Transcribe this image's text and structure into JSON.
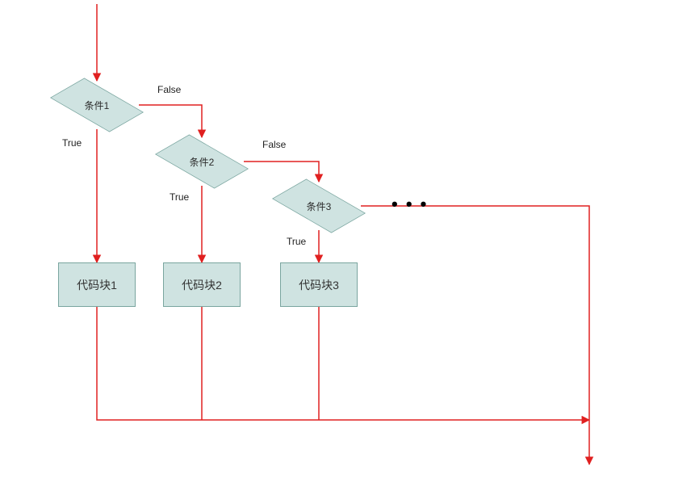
{
  "chart_data": {
    "type": "flowchart",
    "title": "",
    "nodes": [
      {
        "id": "c1",
        "type": "decision",
        "label": "条件1"
      },
      {
        "id": "c2",
        "type": "decision",
        "label": "条件2"
      },
      {
        "id": "c3",
        "type": "decision",
        "label": "条件3"
      },
      {
        "id": "b1",
        "type": "process",
        "label": "代码块1"
      },
      {
        "id": "b2",
        "type": "process",
        "label": "代码块2"
      },
      {
        "id": "b3",
        "type": "process",
        "label": "代码块3"
      },
      {
        "id": "more",
        "type": "ellipsis",
        "label": "• • •"
      }
    ],
    "edges": [
      {
        "from": "start",
        "to": "c1"
      },
      {
        "from": "c1",
        "to": "b1",
        "label": "True"
      },
      {
        "from": "c1",
        "to": "c2",
        "label": "False"
      },
      {
        "from": "c2",
        "to": "b2",
        "label": "True"
      },
      {
        "from": "c2",
        "to": "c3",
        "label": "False"
      },
      {
        "from": "c3",
        "to": "b3",
        "label": "True"
      },
      {
        "from": "c3",
        "to": "more",
        "label": ""
      },
      {
        "from": "b1",
        "to": "end"
      },
      {
        "from": "b2",
        "to": "end"
      },
      {
        "from": "b3",
        "to": "end"
      },
      {
        "from": "more",
        "to": "end"
      }
    ],
    "edge_labels": {
      "true": "True",
      "false": "False"
    },
    "ellipsis": "• • •"
  }
}
